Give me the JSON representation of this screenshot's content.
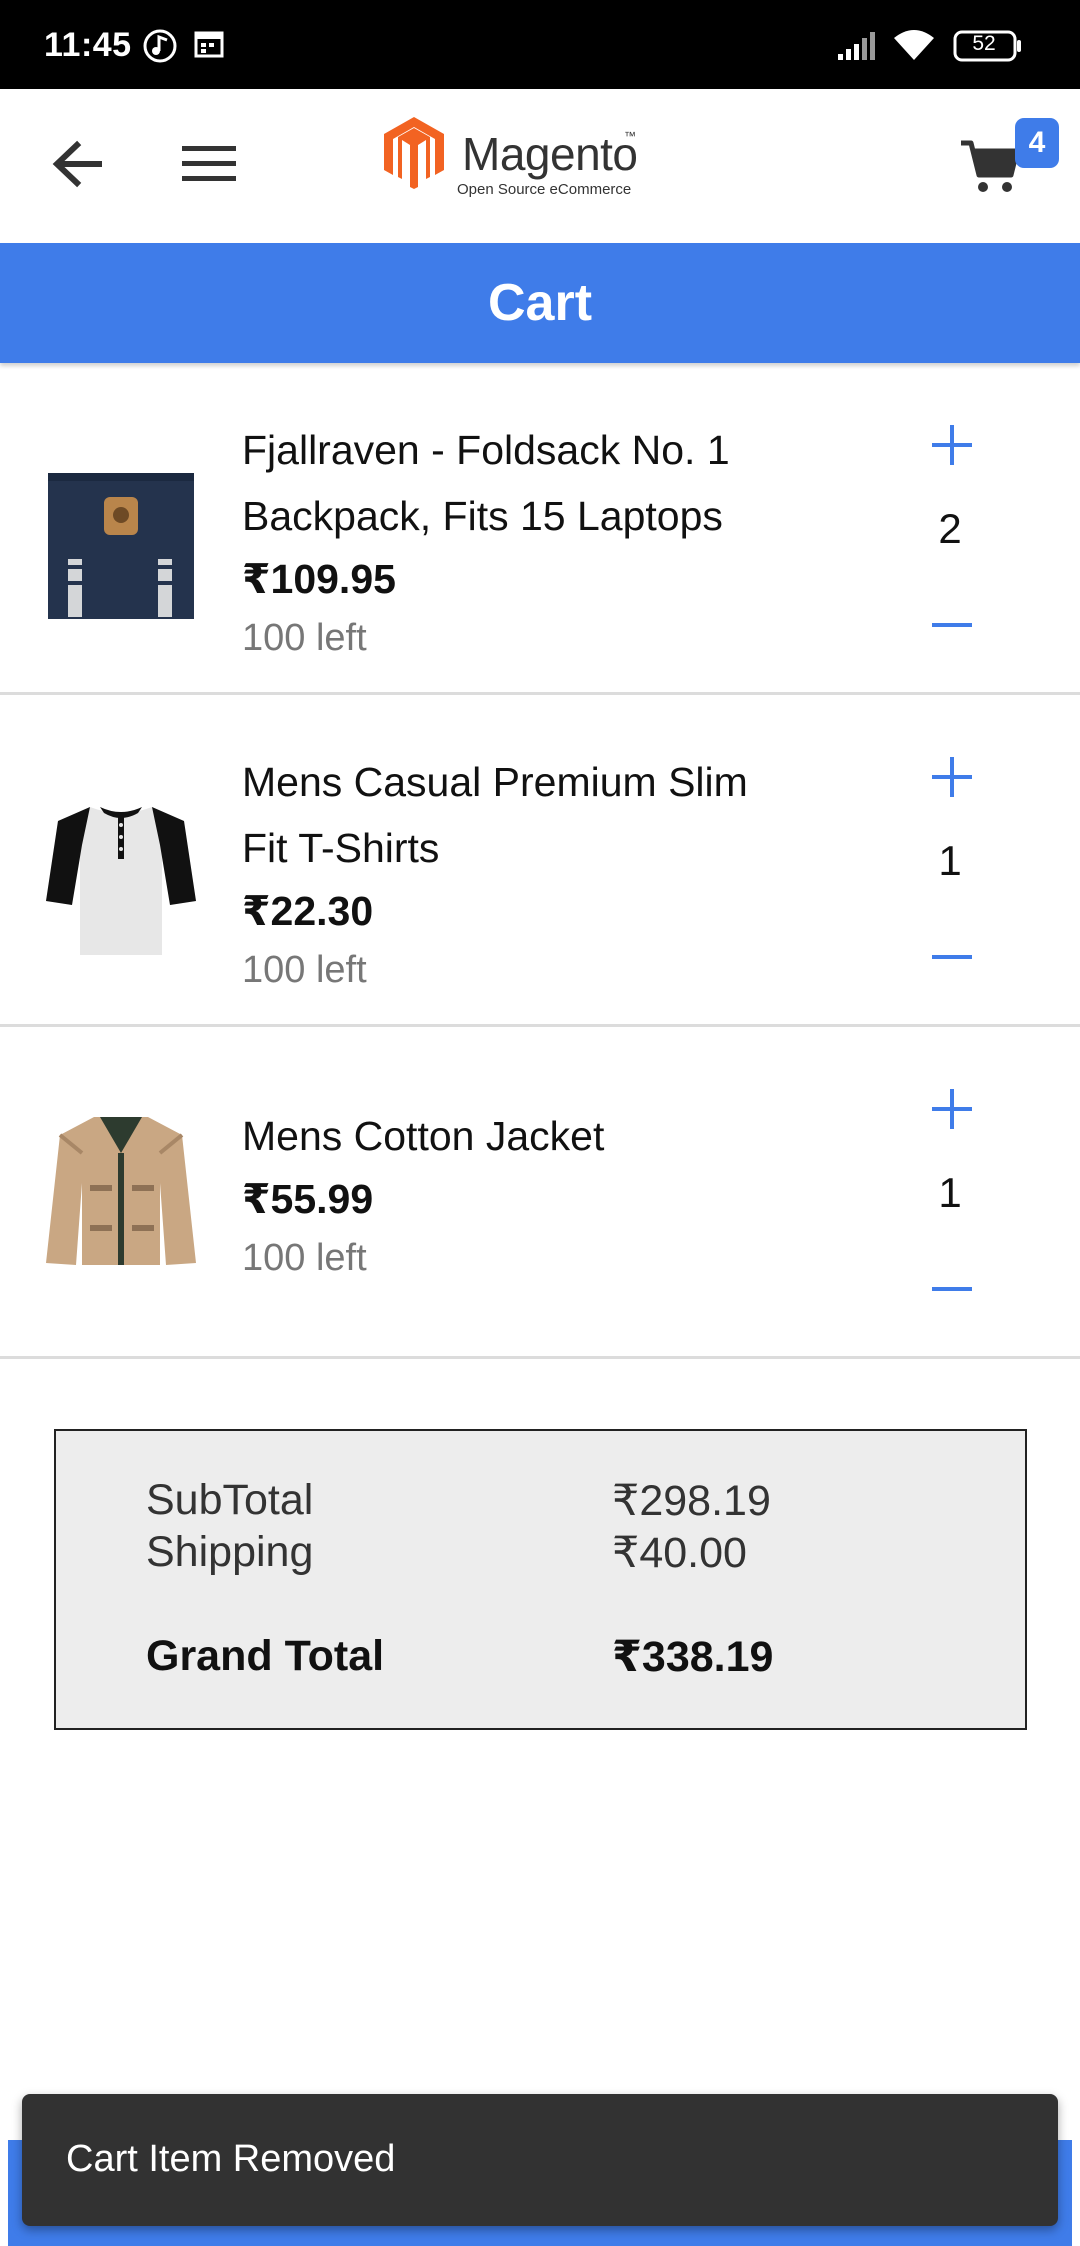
{
  "status_bar": {
    "time": "11:45",
    "battery": "52",
    "icons": [
      "music-note-icon",
      "calendar-icon",
      "signal-icon",
      "wifi-icon",
      "battery-icon"
    ]
  },
  "header": {
    "back_icon": "arrow-left-icon",
    "menu_icon": "hamburger-icon",
    "logo_name": "Magento",
    "logo_tm": "™",
    "logo_tagline": "Open Source eCommerce",
    "cart_icon": "shopping-cart-icon",
    "cart_count": "4"
  },
  "title": "Cart",
  "items": [
    {
      "name_line1": "Fjallraven - Foldsack No. 1",
      "name_line2": "Backpack, Fits 15 Laptops",
      "price": "₹109.95",
      "stock": "100 left",
      "quantity": "2",
      "thumb_icon": "backpack-image"
    },
    {
      "name_line1": "Mens Casual Premium Slim",
      "name_line2": "Fit T-Shirts",
      "price": "₹22.30",
      "stock": "100 left",
      "quantity": "1",
      "thumb_icon": "tshirt-image"
    },
    {
      "name_line1": "Mens Cotton Jacket",
      "price": "₹55.99",
      "stock": "100 left",
      "quantity": "1",
      "thumb_icon": "jacket-image"
    }
  ],
  "summary": {
    "subtotal_label": "SubTotal",
    "subtotal_value": "₹298.19",
    "shipping_label": "Shipping",
    "shipping_value": "₹40.00",
    "grand_label": "Grand Total",
    "grand_value": "₹338.19"
  },
  "snackbar": "Cart Item Removed",
  "colors": {
    "accent": "#3f7ce9",
    "logo_orange": "#f26322",
    "snackbar": "#323232",
    "summary_bg": "#ededed"
  }
}
